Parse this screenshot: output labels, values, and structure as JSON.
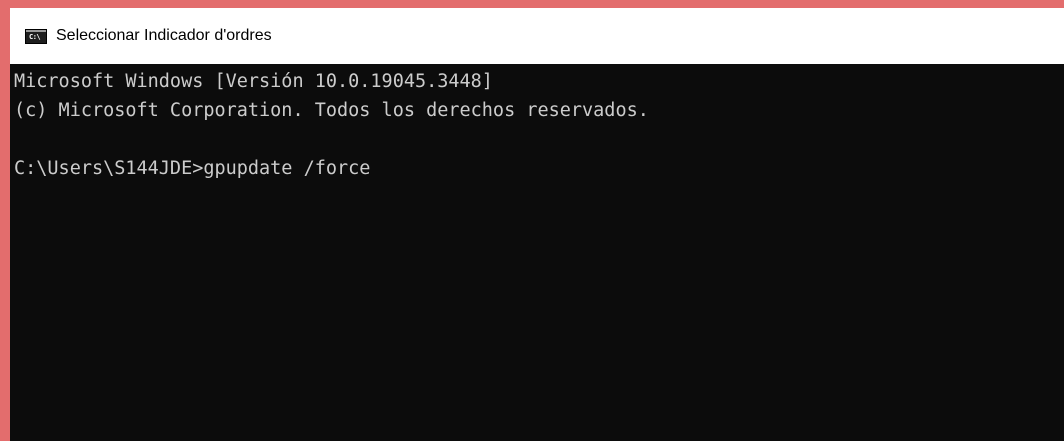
{
  "window": {
    "title": "Seleccionar Indicador d'ordres",
    "icon": "cmd-icon",
    "icon_text": "C:\\"
  },
  "console": {
    "lines": [
      "Microsoft Windows [Versión 10.0.19045.3448]",
      "(c) Microsoft Corporation. Todos los derechos reservados.",
      "",
      "C:\\Users\\S144JDE>gpupdate /force"
    ]
  },
  "colors": {
    "border": "#e36d6d",
    "console_background": "#0c0c0c",
    "console_text": "#cccccc",
    "titlebar_background": "#ffffff"
  }
}
